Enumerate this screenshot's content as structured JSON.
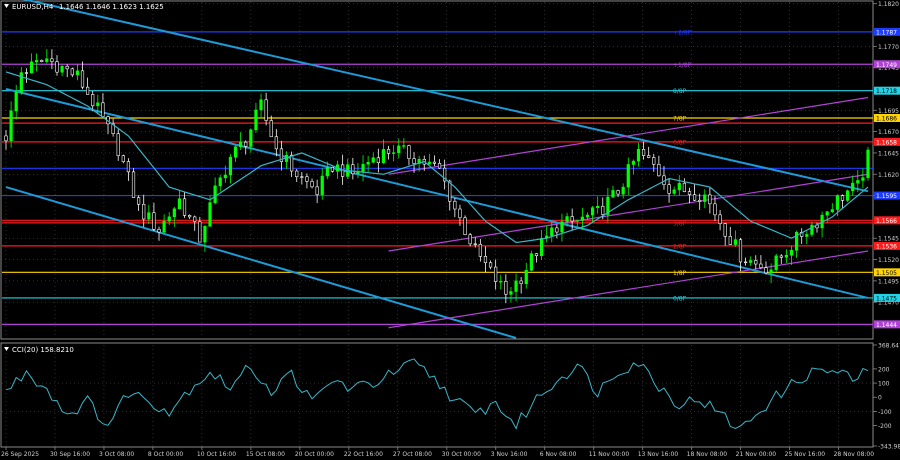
{
  "main_header": {
    "symbol_tf": "EURUSD,H4",
    "ohlc": "1.1646 1.1646 1.1623 1.1625"
  },
  "indicator_header": {
    "label": "CCI(20) 158.8210"
  },
  "colors": {
    "background": "#000000",
    "bull_candle": "#00ff00",
    "bear_candle": "#ffffff",
    "moving_average": "#38b6c8",
    "channel_cyan": "#1e9ad6",
    "channel_violet": "#b043d6",
    "murrey_red": "#ff1a1a",
    "murrey_blue": "#1e3cff",
    "murrey_yellow": "#ffd400",
    "murrey_cyan": "#22d3e6",
    "murrey_violet": "#b043d6",
    "cci_line": "#38b6c8",
    "grid": "#5a5a5a",
    "axis_text": "#cfcfcf"
  },
  "chart_data": [
    {
      "type": "candlestick",
      "name": "price",
      "y_ticks": [
        "1.1820",
        "1.1770",
        "1.1745",
        "1.1695",
        "1.1670",
        "1.1645",
        "1.1620",
        "1.1595",
        "1.1545",
        "1.1520",
        "1.1495",
        "1.1470"
      ],
      "ylim": [
        1.1428,
        1.1822
      ],
      "x_ticks": [
        "26 Sep 2025",
        "30 Sep 16:00",
        "3 Oct 08:00",
        "8 Oct 00:00",
        "10 Oct 16:00",
        "15 Oct 08:00",
        "20 Oct 00:00",
        "22 Oct 16:00",
        "27 Oct 08:00",
        "30 Oct 00:00",
        "3 Nov 16:00",
        "6 Nov 08:00",
        "11 Nov 00:00",
        "13 Nov 16:00",
        "18 Nov 08:00",
        "21 Nov 00:00",
        "25 Nov 16:00",
        "28 Nov 08:00"
      ],
      "close_anchors": [
        [
          0,
          1.1665
        ],
        [
          3,
          1.174
        ],
        [
          8,
          1.1755
        ],
        [
          14,
          1.1735
        ],
        [
          18,
          1.1695
        ],
        [
          22,
          1.165
        ],
        [
          26,
          1.158
        ],
        [
          30,
          1.1555
        ],
        [
          34,
          1.159
        ],
        [
          38,
          1.1545
        ],
        [
          41,
          1.16
        ],
        [
          44,
          1.164
        ],
        [
          47,
          1.166
        ],
        [
          50,
          1.17
        ],
        [
          53,
          1.165
        ],
        [
          57,
          1.162
        ],
        [
          61,
          1.16
        ],
        [
          64,
          1.163
        ],
        [
          68,
          1.162
        ],
        [
          72,
          1.164
        ],
        [
          76,
          1.165
        ],
        [
          80,
          1.164
        ],
        [
          85,
          1.1625
        ],
        [
          88,
          1.158
        ],
        [
          92,
          1.153
        ],
        [
          95,
          1.1505
        ],
        [
          98,
          1.148
        ],
        [
          101,
          1.15
        ],
        [
          104,
          1.153
        ],
        [
          108,
          1.156
        ],
        [
          112,
          1.1565
        ],
        [
          116,
          1.1575
        ],
        [
          120,
          1.16
        ],
        [
          124,
          1.1645
        ],
        [
          127,
          1.163
        ],
        [
          130,
          1.1605
        ],
        [
          134,
          1.16
        ],
        [
          137,
          1.1595
        ],
        [
          141,
          1.1555
        ],
        [
          144,
          1.1525
        ],
        [
          147,
          1.1515
        ],
        [
          150,
          1.151
        ],
        [
          153,
          1.153
        ],
        [
          156,
          1.155
        ],
        [
          159,
          1.1565
        ],
        [
          162,
          1.1585
        ],
        [
          165,
          1.16
        ],
        [
          167,
          1.1605
        ],
        [
          169,
          1.164
        ]
      ],
      "bar_count": 170,
      "moving_average_anchors": [
        [
          0,
          1.174
        ],
        [
          8,
          1.1725
        ],
        [
          16,
          1.17
        ],
        [
          24,
          1.1665
        ],
        [
          32,
          1.1605
        ],
        [
          40,
          1.159
        ],
        [
          50,
          1.163
        ],
        [
          58,
          1.1645
        ],
        [
          66,
          1.1625
        ],
        [
          74,
          1.162
        ],
        [
          82,
          1.1635
        ],
        [
          88,
          1.1605
        ],
        [
          94,
          1.1565
        ],
        [
          100,
          1.154
        ],
        [
          106,
          1.1545
        ],
        [
          114,
          1.156
        ],
        [
          122,
          1.159
        ],
        [
          130,
          1.1615
        ],
        [
          138,
          1.1605
        ],
        [
          146,
          1.1565
        ],
        [
          154,
          1.1545
        ],
        [
          162,
          1.157
        ],
        [
          169,
          1.1605
        ]
      ],
      "channel_lines": [
        {
          "color": "channel_cyan",
          "from": [
            0,
            1.183
          ],
          "to": [
            169,
            1.16
          ]
        },
        {
          "color": "channel_cyan",
          "from": [
            0,
            1.172
          ],
          "to": [
            169,
            1.1475
          ]
        },
        {
          "color": "channel_cyan",
          "from": [
            0,
            1.1605
          ],
          "to": [
            100,
            1.1428
          ]
        },
        {
          "color": "channel_violet",
          "from": [
            75,
            1.144
          ],
          "to": [
            169,
            1.153
          ]
        },
        {
          "color": "channel_violet",
          "from": [
            75,
            1.153
          ],
          "to": [
            169,
            1.162
          ]
        },
        {
          "color": "channel_violet",
          "from": [
            75,
            1.162
          ],
          "to": [
            169,
            1.171
          ]
        }
      ],
      "murrey_levels": [
        {
          "label": "+2/8P",
          "value": 1.1787,
          "color": "murrey_blue",
          "axis_value": "1.1787"
        },
        {
          "label": "+1/8P",
          "value": 1.1749,
          "color": "murrey_violet",
          "axis_value": "1.1749"
        },
        {
          "label": "8/8P",
          "value": 1.1718,
          "color": "murrey_cyan",
          "axis_value": "1.1718"
        },
        {
          "label": "7/8P",
          "value": 1.1686,
          "color": "murrey_yellow",
          "axis_value": "1.1686"
        },
        {
          "label": "",
          "value": 1.168,
          "color": "murrey_red",
          "axis_value": ""
        },
        {
          "label": "6/8P",
          "value": 1.1658,
          "color": "murrey_red",
          "axis_value": "1.1658"
        },
        {
          "label": "",
          "value": 1.1627,
          "color": "murrey_blue",
          "axis_value": ""
        },
        {
          "label": "",
          "value": 1.1595,
          "color": "murrey_blue",
          "axis_value": "1.1595"
        },
        {
          "label": "",
          "value": 1.1566,
          "color": "murrey_red",
          "axis_value": "1.1566"
        },
        {
          "label": "3/8P",
          "value": 1.1563,
          "color": "murrey_red",
          "axis_value": ""
        },
        {
          "label": "2/8P",
          "value": 1.1536,
          "color": "murrey_red",
          "axis_value": "1.1536"
        },
        {
          "label": "1/8P",
          "value": 1.1505,
          "color": "murrey_yellow",
          "axis_value": "1.1505"
        },
        {
          "label": "0/8P",
          "value": 1.1475,
          "color": "murrey_cyan",
          "axis_value": "1.1475"
        },
        {
          "label": "",
          "value": 1.1444,
          "color": "murrey_violet",
          "axis_value": "1.1444"
        }
      ]
    },
    {
      "type": "line",
      "name": "CCI(20)",
      "y_ticks": [
        "368.6478",
        "200",
        "100",
        "0",
        "-100",
        "-200",
        "-343.9844"
      ],
      "ylim": [
        -343.9844,
        368.6478
      ],
      "levels": [
        100,
        -100
      ],
      "anchors": [
        [
          0,
          40
        ],
        [
          4,
          180
        ],
        [
          8,
          60
        ],
        [
          12,
          -120
        ],
        [
          16,
          -30
        ],
        [
          20,
          -200
        ],
        [
          24,
          40
        ],
        [
          28,
          -20
        ],
        [
          32,
          -100
        ],
        [
          36,
          60
        ],
        [
          40,
          180
        ],
        [
          44,
          70
        ],
        [
          48,
          220
        ],
        [
          52,
          40
        ],
        [
          56,
          170
        ],
        [
          60,
          -40
        ],
        [
          64,
          120
        ],
        [
          68,
          60
        ],
        [
          72,
          100
        ],
        [
          76,
          170
        ],
        [
          80,
          240
        ],
        [
          84,
          130
        ],
        [
          88,
          -20
        ],
        [
          92,
          -120
        ],
        [
          96,
          -40
        ],
        [
          100,
          -200
        ],
        [
          104,
          -10
        ],
        [
          108,
          120
        ],
        [
          112,
          230
        ],
        [
          116,
          40
        ],
        [
          120,
          190
        ],
        [
          124,
          250
        ],
        [
          128,
          80
        ],
        [
          132,
          -50
        ],
        [
          136,
          -10
        ],
        [
          140,
          -120
        ],
        [
          144,
          -230
        ],
        [
          148,
          -80
        ],
        [
          152,
          30
        ],
        [
          156,
          140
        ],
        [
          160,
          200
        ],
        [
          164,
          160
        ],
        [
          167,
          120
        ],
        [
          169,
          200
        ]
      ]
    }
  ]
}
